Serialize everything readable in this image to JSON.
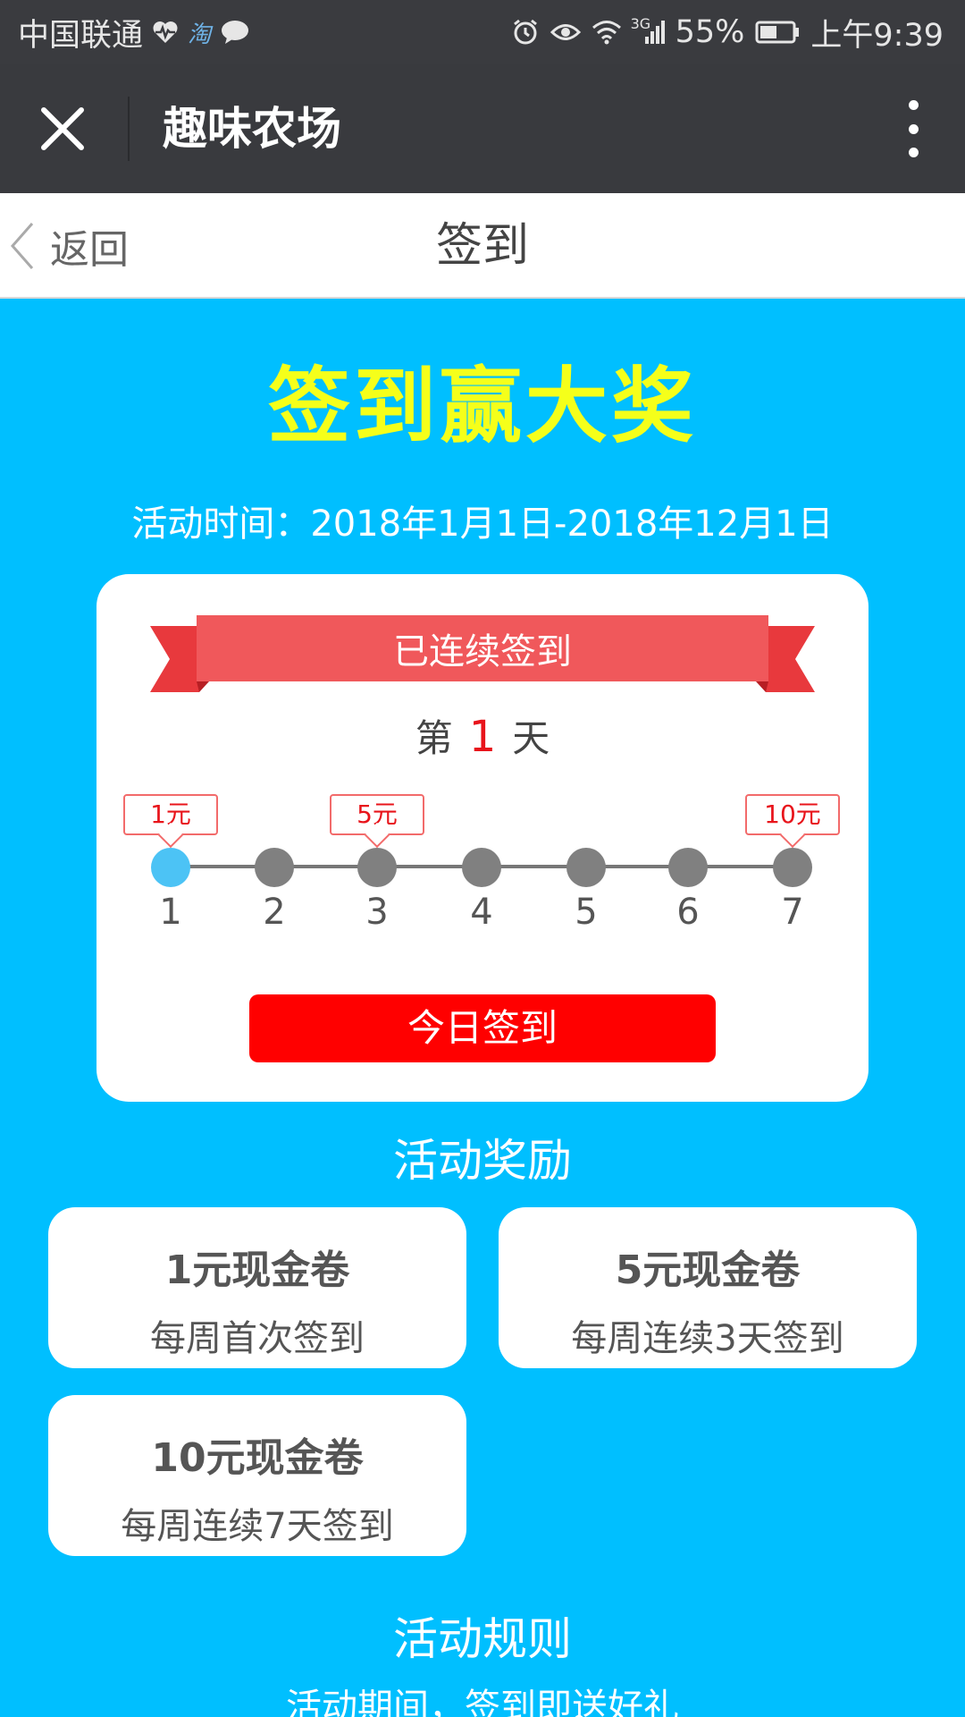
{
  "status_bar": {
    "carrier": "中国联通",
    "battery": "55%",
    "network": "3G",
    "time": "上午9:39",
    "icons": [
      "heart-rate-icon",
      "taobao-icon",
      "chat-bubble-icon",
      "alarm-icon",
      "eye-icon",
      "wifi-icon",
      "signal-icon",
      "battery-icon"
    ]
  },
  "title_bar": {
    "title": "趣味农场"
  },
  "page_header": {
    "back_label": "返回",
    "title": "签到"
  },
  "hero": {
    "title": "签到赢大奖",
    "period": "活动时间：2018年1月1日-2018年12月1日"
  },
  "card": {
    "ribbon_label": "已连续签到",
    "streak_prefix": "第",
    "streak_days": "1",
    "streak_suffix": "天",
    "days": [
      "1",
      "2",
      "3",
      "4",
      "5",
      "6",
      "7"
    ],
    "current_day": 1,
    "tags": [
      {
        "day": 1,
        "label": "1元"
      },
      {
        "day": 3,
        "label": "5元"
      },
      {
        "day": 7,
        "label": "10元"
      }
    ],
    "checkin_button": "今日签到"
  },
  "rewards": {
    "title": "活动奖励",
    "items": [
      {
        "name": "1元现金卷",
        "condition": "每周首次签到"
      },
      {
        "name": "5元现金卷",
        "condition": "每周连续3天签到"
      },
      {
        "name": "10元现金卷",
        "condition": "每周连续7天签到"
      }
    ]
  },
  "rules": {
    "title": "活动规则",
    "text": "活动期间，签到即送好礼"
  },
  "colors": {
    "background": "#00BFFF",
    "hero_title": "#F5FF1A",
    "ribbon": "#F0585B",
    "button": "#FF0000",
    "active_dot": "#4CC3F5"
  }
}
